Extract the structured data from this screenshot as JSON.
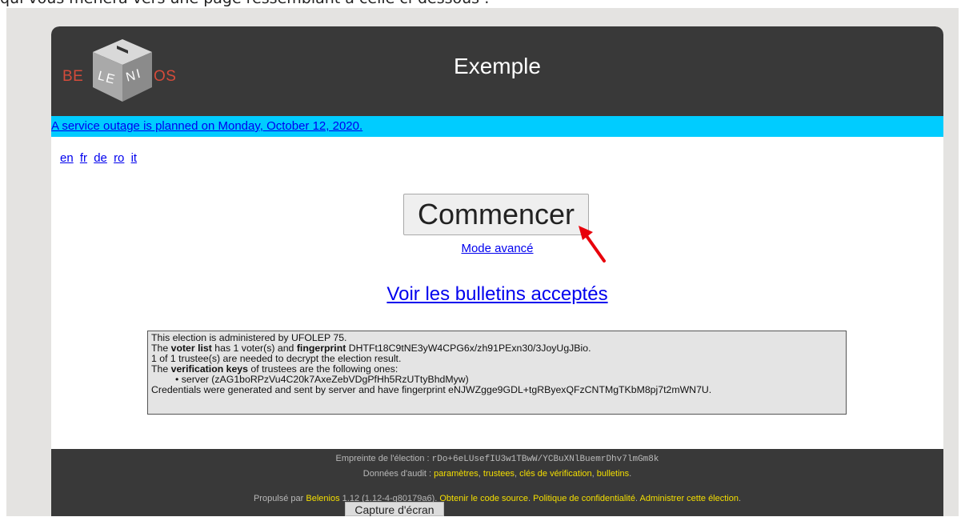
{
  "caption": "qui vous mènera vers une page ressemblant à celle ci-dessous :",
  "header": {
    "logo_left": "BE",
    "logo_cube": "LENI",
    "logo_right": "OS",
    "title": "Exemple"
  },
  "banner": {
    "text": "A service outage is planned on Monday, October 12, 2020."
  },
  "languages": [
    "en",
    "fr",
    "de",
    "ro",
    "it"
  ],
  "main": {
    "start_button": "Commencer",
    "advanced_link": "Mode avancé",
    "ballots_link": "Voir les bulletins acceptés"
  },
  "info": {
    "line1": "This election is administered by UFOLEP 75.",
    "line2_a": "The ",
    "line2_b": "voter list",
    "line2_c": " has 1 voter(s) and ",
    "line2_d": "fingerprint",
    "line2_e": " DHTFt18C9tNE3yW4CPG6x/zh91PExn30/3JoyUgJBio.",
    "line3": "1 of 1 trustee(s) are needed to decrypt the election result.",
    "line4_a": "The ",
    "line4_b": "verification keys",
    "line4_c": " of trustees are the following ones:",
    "line5": "•  server (zAG1boRPzVu4C20k7AxeZebVDgPfHh5RzUTtyBhdMyw)",
    "line6": "Credentials were generated and sent by server and have fingerprint eNJWZgge9GDL+tgRByexQFzCNTMgTKbM8pj7t2mWN7U."
  },
  "footer": {
    "fingerprint_label": "Empreinte de l'élection : ",
    "fingerprint_value": "rDo+6eLUsefIU3w1TBwW/YCBuXNlBuemrDhv7lmGm8k",
    "audit_label": "Données d'audit : ",
    "audit_links": [
      "paramètres",
      "trustees",
      "clés de vérification",
      "bulletins"
    ],
    "powered_label": "Propulsé par ",
    "powered_name": "Belenios",
    "version": " 1.12 (1.12-4-g80179a6). ",
    "source_link": "Obtenir le code source",
    "privacy_link": "Politique de confidentialité",
    "admin_link": "Administrer cette élection"
  },
  "screenshot_label": "Capture d'écran",
  "colors": {
    "header_bg": "#393939",
    "banner_bg": "#00ccff",
    "link": "#0000ee",
    "footer_link": "#f5df00",
    "logo_red": "#d44b3a",
    "annotation_arrow": "#e8000b"
  }
}
